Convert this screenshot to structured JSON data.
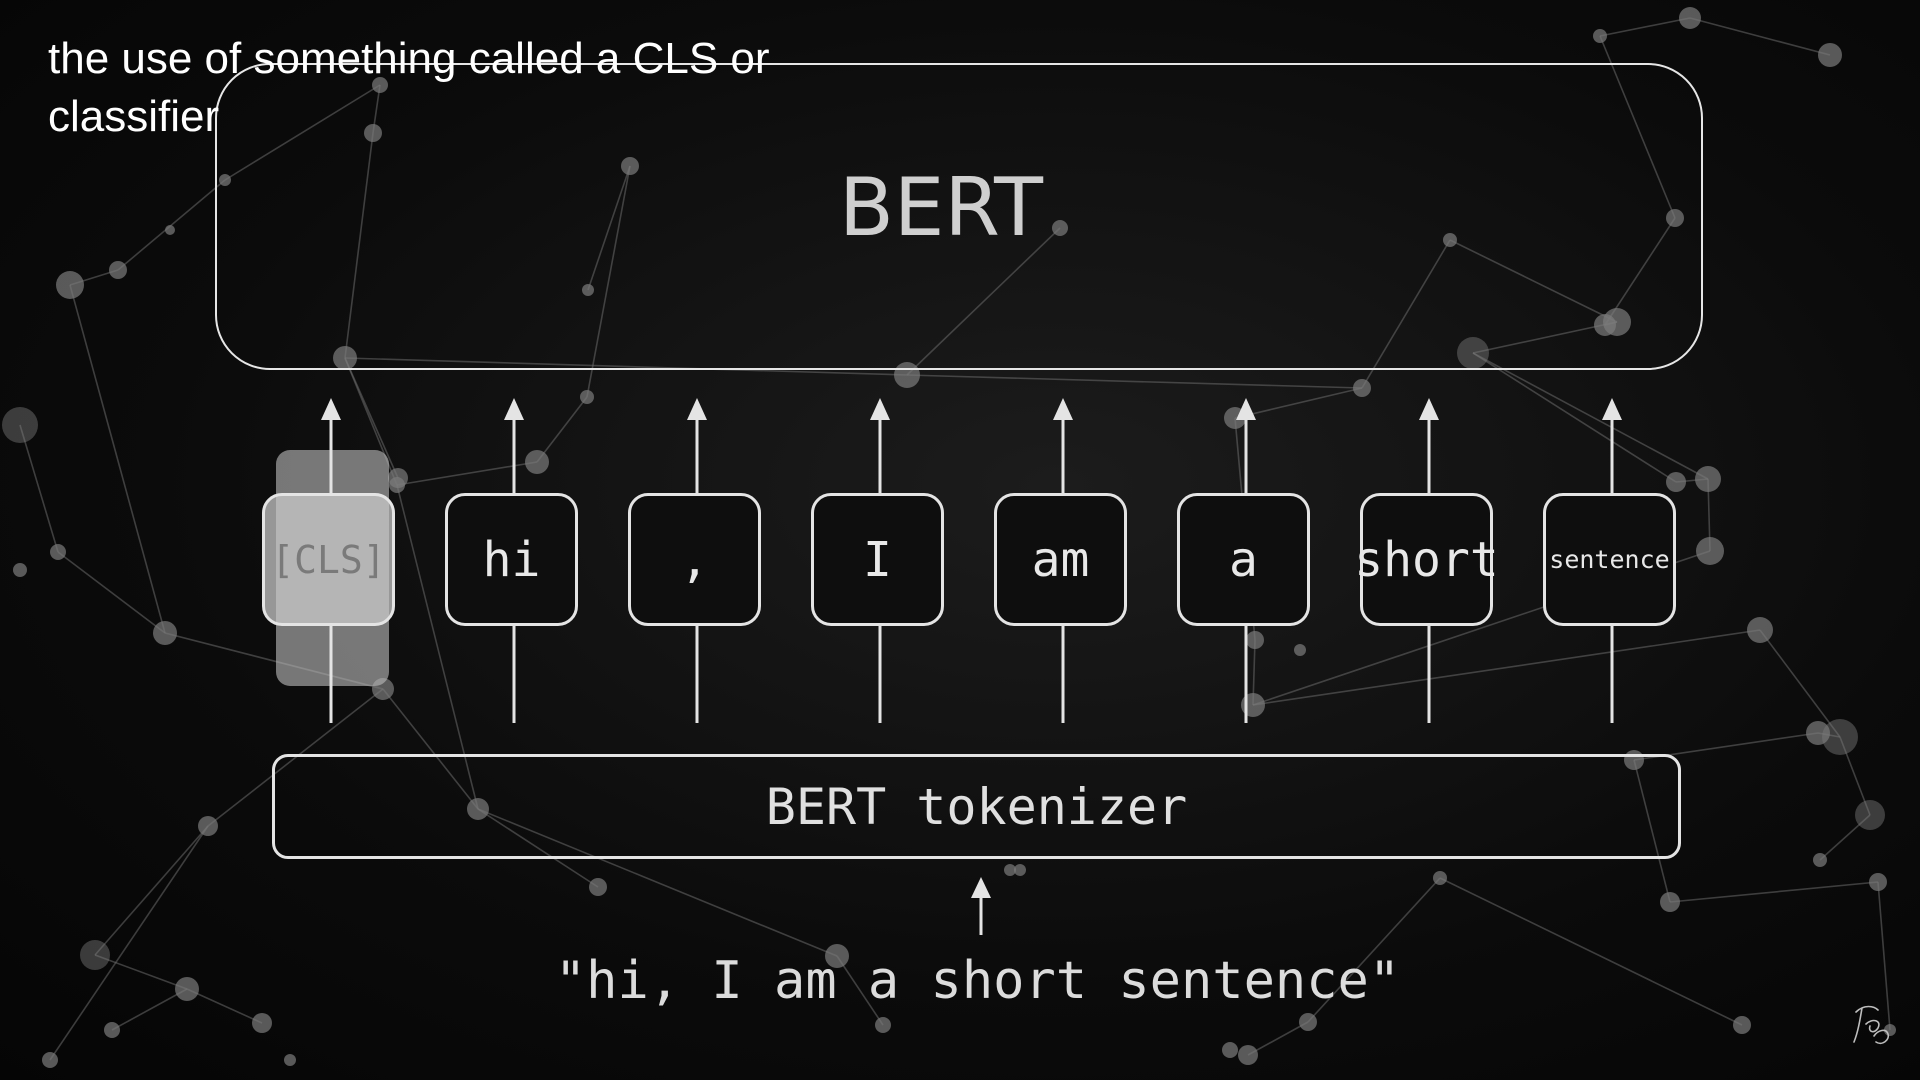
{
  "caption": "the use of something called a CLS or classifier",
  "model": {
    "title": "BERT"
  },
  "tokens": [
    {
      "text": "[CLS]",
      "highlighted": true
    },
    {
      "text": "hi",
      "highlighted": false
    },
    {
      "text": ",",
      "highlighted": false
    },
    {
      "text": "I",
      "highlighted": false
    },
    {
      "text": "am",
      "highlighted": false
    },
    {
      "text": "a",
      "highlighted": false
    },
    {
      "text": "short",
      "highlighted": false
    },
    {
      "text": "sentence",
      "highlighted": false
    }
  ],
  "tokenizer": {
    "label": "BERT tokenizer"
  },
  "input": {
    "sentence": "\"hi, I am a short sentence\""
  },
  "colors": {
    "background": "#0a0a0a",
    "stroke": "#e4e4e4",
    "cls_highlight": "#b9b9b9",
    "text": "#e8e8e8"
  },
  "icons": {
    "signature": "handwritten-signature-icon"
  }
}
